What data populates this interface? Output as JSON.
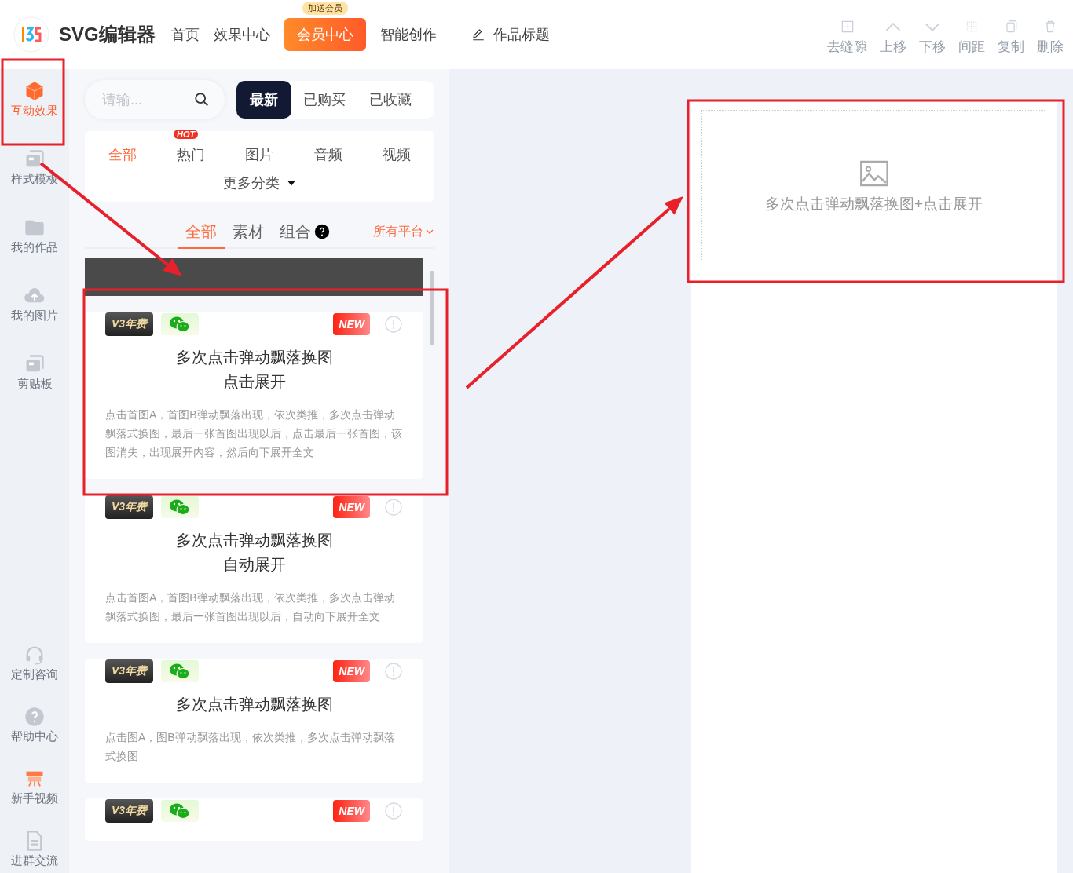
{
  "header": {
    "logo": "SVG编辑器",
    "nav": [
      {
        "label": "首页",
        "kind": "link"
      },
      {
        "label": "效果中心",
        "kind": "link"
      },
      {
        "label": "会员中心",
        "kind": "highlight",
        "badge": "加送会员"
      },
      {
        "label": "智能创作",
        "kind": "link"
      }
    ],
    "title_field": "作品标题",
    "tools": [
      {
        "label": "去缝隙",
        "disabled": true
      },
      {
        "label": "上移",
        "disabled": true
      },
      {
        "label": "下移",
        "disabled": true
      },
      {
        "label": "间距",
        "disabled": true
      },
      {
        "label": "复制",
        "disabled": true
      },
      {
        "label": "删除",
        "disabled": true
      }
    ]
  },
  "sidebar": {
    "items": [
      {
        "label": "互动效果",
        "selected": true
      },
      {
        "label": "样式模板",
        "selected": false
      },
      {
        "label": "我的作品",
        "selected": false
      },
      {
        "label": "我的图片",
        "selected": false
      },
      {
        "label": "剪贴板",
        "selected": false
      }
    ],
    "bottom_items": [
      {
        "label": "定制咨询",
        "selected": false
      },
      {
        "label": "帮助中心",
        "selected": false
      },
      {
        "label": "新手视频",
        "selected": false
      },
      {
        "label": "进群交流",
        "selected": false
      }
    ]
  },
  "panel": {
    "search": {
      "placeholder": "请输..."
    },
    "segments": [
      {
        "label": "最新",
        "selected": true
      },
      {
        "label": "已购买",
        "selected": false
      },
      {
        "label": "已收藏",
        "selected": false
      }
    ],
    "categories": [
      {
        "label": "全部",
        "selected": true
      },
      {
        "label": "热门",
        "selected": false,
        "badge": "HOT"
      },
      {
        "label": "图片",
        "selected": false
      },
      {
        "label": "音频",
        "selected": false
      },
      {
        "label": "视频",
        "selected": false
      }
    ],
    "more_categories": "更多分类",
    "subtabs": [
      {
        "label": "全部",
        "selected": true
      },
      {
        "label": "素材",
        "selected": false
      },
      {
        "label": "组合",
        "selected": false,
        "help": true
      }
    ],
    "platform": "所有平台",
    "cards": [
      {
        "badges": [
          "V3年费",
          "NEW"
        ],
        "title_lines": [
          "多次点击弹动飘落换图",
          "点击展开"
        ],
        "description": "点击首图A，首图B弹动飘落出现，依次类推，多次点击弹动飘落式换图，最后一张首图出现以后，点击最后一张首图，该图消失，出现展开内容，然后向下展开全文"
      },
      {
        "badges": [
          "V3年费",
          "NEW"
        ],
        "title_lines": [
          "多次点击弹动飘落换图",
          "自动展开"
        ],
        "description": "点击首图A，首图B弹动飘落出现，依次类推，多次点击弹动飘落式换图，最后一张首图出现以后，自动向下展开全文"
      },
      {
        "badges": [
          "V3年费",
          "NEW"
        ],
        "title_lines": [
          "多次点击弹动飘落换图"
        ],
        "description": "点击图A，图B弹动飘落出现，依次类推，多次点击弹动飘落式换图"
      },
      {
        "badges": [
          "V3年费",
          "NEW"
        ]
      }
    ]
  },
  "canvas": {
    "preview_label": "多次点击弹动飘落换图+点击展开"
  },
  "annotations": [
    {
      "kind": "box"
    },
    {
      "kind": "box"
    },
    {
      "kind": "box"
    },
    {
      "kind": "arrow"
    },
    {
      "kind": "arrow"
    }
  ]
}
